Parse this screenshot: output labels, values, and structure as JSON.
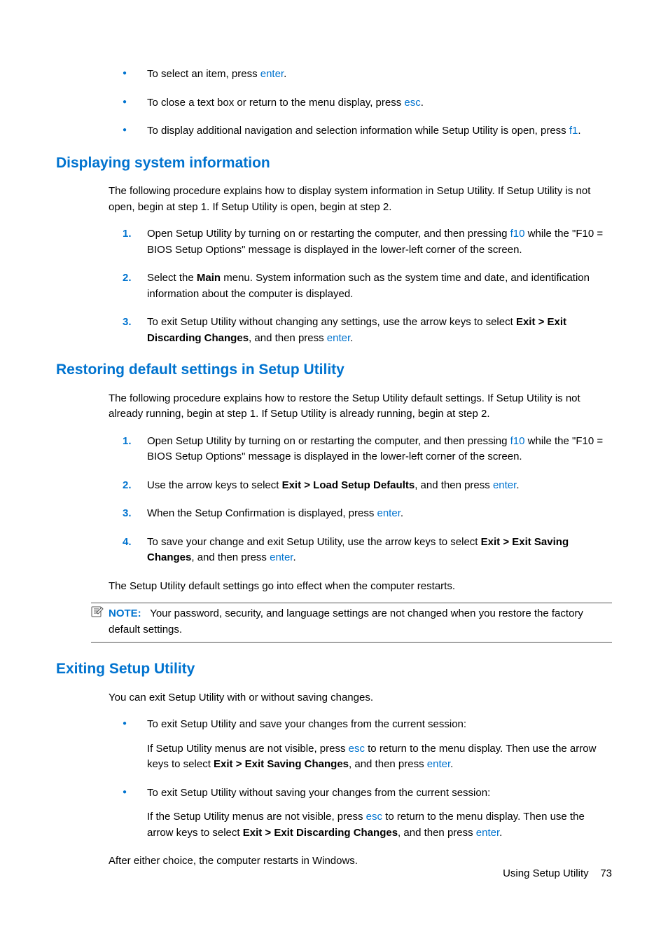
{
  "top_bullets": {
    "b1_a": "To select an item, press ",
    "b1_key": "enter",
    "b1_b": ".",
    "b2_a": "To close a text box or return to the menu display, press ",
    "b2_key": "esc",
    "b2_b": ".",
    "b3_a": "To display additional navigation and selection information while Setup Utility is open, press ",
    "b3_key": "f1",
    "b3_b": "."
  },
  "sec1": {
    "title": "Displaying system information",
    "intro": "The following procedure explains how to display system information in Setup Utility. If Setup Utility is not open, begin at step 1. If Setup Utility is open, begin at step 2.",
    "s1_a": "Open Setup Utility by turning on or restarting the computer, and then pressing ",
    "s1_key": "f10",
    "s1_b": " while the \"F10 = BIOS Setup Options\" message is displayed in the lower-left corner of the screen.",
    "s2_a": "Select the ",
    "s2_bold": "Main",
    "s2_b": " menu. System information such as the system time and date, and identification information about the computer is displayed.",
    "s3_a": "To exit Setup Utility without changing any settings, use the arrow keys to select ",
    "s3_bold": "Exit > Exit Discarding Changes",
    "s3_b": ", and then press ",
    "s3_key": "enter",
    "s3_c": "."
  },
  "sec2": {
    "title": "Restoring default settings in Setup Utility",
    "intro": "The following procedure explains how to restore the Setup Utility default settings. If Setup Utility is not already running, begin at step 1. If Setup Utility is already running, begin at step 2.",
    "s1_a": "Open Setup Utility by turning on or restarting the computer, and then pressing ",
    "s1_key": "f10",
    "s1_b": " while the \"F10 = BIOS Setup Options\" message is displayed in the lower-left corner of the screen.",
    "s2_a": "Use the arrow keys to select ",
    "s2_bold": "Exit > Load Setup Defaults",
    "s2_b": ", and then press ",
    "s2_key": "enter",
    "s2_c": ".",
    "s3_a": "When the Setup Confirmation is displayed, press ",
    "s3_key": "enter",
    "s3_b": ".",
    "s4_a": "To save your change and exit Setup Utility, use the arrow keys to select ",
    "s4_bold": "Exit > Exit Saving Changes",
    "s4_b": ", and then press ",
    "s4_key": "enter",
    "s4_c": ".",
    "follow": "The Setup Utility default settings go into effect when the computer restarts.",
    "note_label": "NOTE:",
    "note_text": "Your password, security, and language settings are not changed when you restore the factory default settings."
  },
  "sec3": {
    "title": "Exiting Setup Utility",
    "intro": "You can exit Setup Utility with or without saving changes.",
    "b1_head": "To exit Setup Utility and save your changes from the current session:",
    "b1_a": "If Setup Utility menus are not visible, press ",
    "b1_key1": "esc",
    "b1_b": " to return to the menu display. Then use the arrow keys to select ",
    "b1_bold": "Exit > Exit Saving Changes",
    "b1_c": ", and then press ",
    "b1_key2": "enter",
    "b1_d": ".",
    "b2_head": "To exit Setup Utility without saving your changes from the current session:",
    "b2_a": "If the Setup Utility menus are not visible, press ",
    "b2_key1": "esc",
    "b2_b": " to return to the menu display. Then use the arrow keys to select ",
    "b2_bold": "Exit > Exit Discarding Changes",
    "b2_c": ", and then press ",
    "b2_key2": "enter",
    "b2_d": ".",
    "follow": "After either choice, the computer restarts in Windows."
  },
  "footer": {
    "label": "Using Setup Utility",
    "page": "73"
  }
}
